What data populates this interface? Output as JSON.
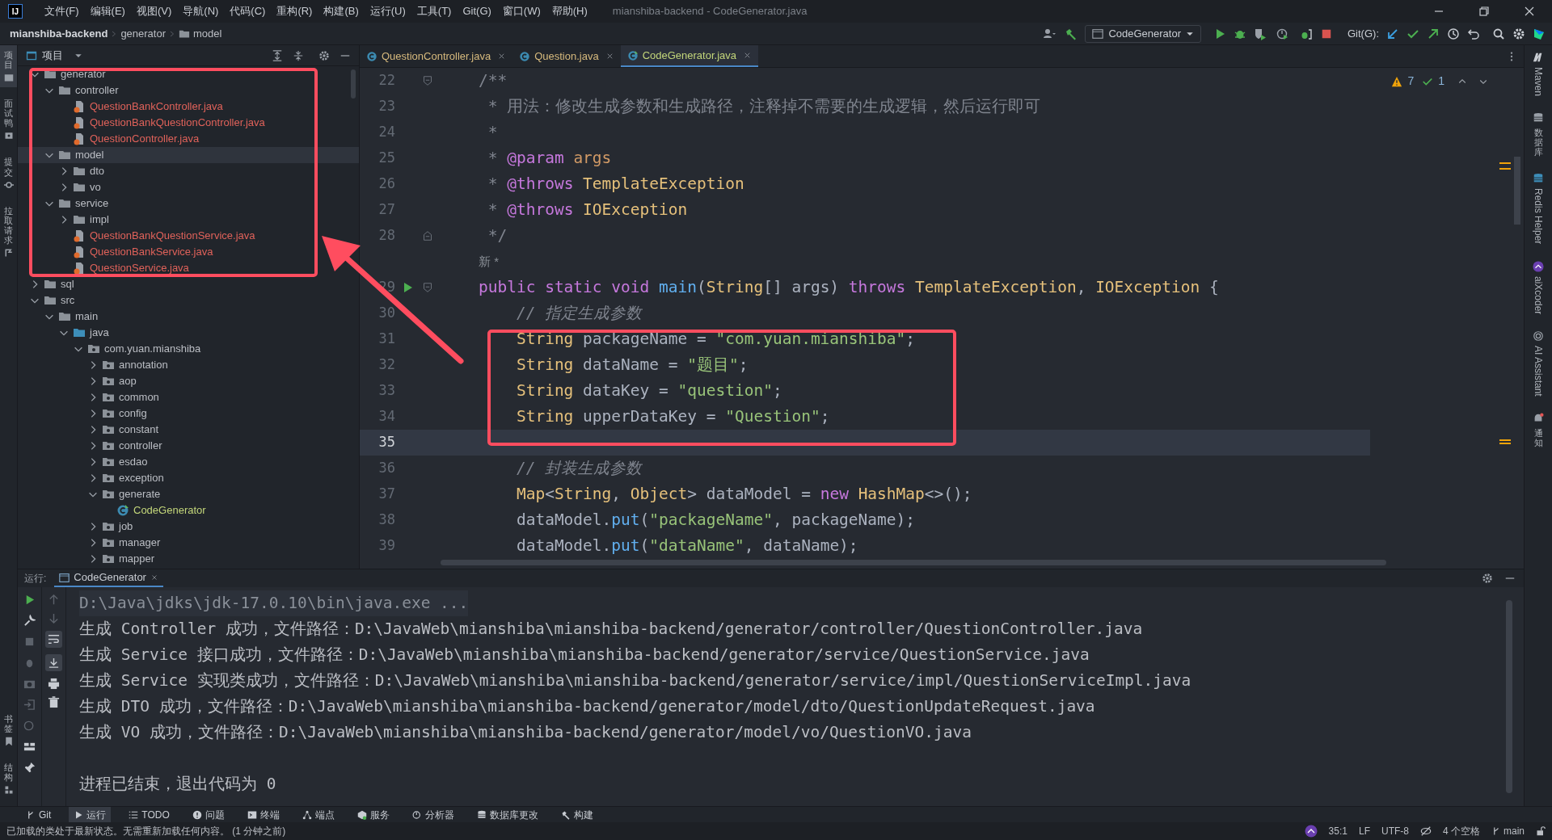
{
  "title_bar": {
    "logo": "IJ",
    "title": "mianshiba-backend - CodeGenerator.java",
    "menus": [
      "文件(F)",
      "编辑(E)",
      "视图(V)",
      "导航(N)",
      "代码(C)",
      "重构(R)",
      "构建(B)",
      "运行(U)",
      "工具(T)",
      "Git(G)",
      "窗口(W)",
      "帮助(H)"
    ]
  },
  "navigation_bar": {
    "breadcrumbs": [
      {
        "label": "mianshiba-backend",
        "kind": "project"
      },
      {
        "label": "generator",
        "kind": "plain"
      },
      {
        "label": "model",
        "kind": "folder"
      }
    ],
    "run_configuration": "CodeGenerator",
    "git_label": "Git(G):"
  },
  "left_tool_strip": {
    "top": [
      {
        "label": "项目",
        "selected": true
      },
      {
        "label": "面试鸭",
        "selected": false
      },
      {
        "label": "提交",
        "selected": false
      },
      {
        "label": "拉取请求",
        "selected": false
      }
    ],
    "bottom": [
      {
        "label": "书签",
        "selected": false
      },
      {
        "label": "结构",
        "selected": false
      }
    ]
  },
  "project_panel": {
    "title": "项目",
    "tree": [
      {
        "label": "generator",
        "kind": "folder",
        "expanded": true,
        "selected": false,
        "children": [
          {
            "label": "controller",
            "kind": "folder",
            "expanded": true,
            "selected": false,
            "children": [
              {
                "label": "QuestionBankController.java",
                "kind": "java",
                "color": "#e0625a",
                "selected": false
              },
              {
                "label": "QuestionBankQuestionController.java",
                "kind": "java",
                "color": "#e0625a",
                "selected": false
              },
              {
                "label": "QuestionController.java",
                "kind": "java",
                "color": "#e0625a",
                "selected": false
              }
            ]
          },
          {
            "label": "model",
            "kind": "folder",
            "expanded": true,
            "selected": true,
            "children": [
              {
                "label": "dto",
                "kind": "folder",
                "expanded": false,
                "selected": false
              },
              {
                "label": "vo",
                "kind": "folder",
                "expanded": false,
                "selected": false
              }
            ]
          },
          {
            "label": "service",
            "kind": "folder",
            "expanded": true,
            "selected": false,
            "children": [
              {
                "label": "impl",
                "kind": "folder",
                "expanded": false,
                "selected": false
              },
              {
                "label": "QuestionBankQuestionService.java",
                "kind": "java",
                "color": "#e0625a",
                "selected": false
              },
              {
                "label": "QuestionBankService.java",
                "kind": "java",
                "color": "#e0625a",
                "selected": false
              },
              {
                "label": "QuestionService.java",
                "kind": "java",
                "color": "#e0625a",
                "selected": false
              }
            ]
          }
        ]
      },
      {
        "label": "sql",
        "kind": "folder",
        "expanded": false,
        "selected": false
      },
      {
        "label": "src",
        "kind": "folder",
        "expanded": true,
        "selected": false,
        "children": [
          {
            "label": "main",
            "kind": "folder",
            "expanded": true,
            "selected": false,
            "children": [
              {
                "label": "java",
                "kind": "source",
                "expanded": true,
                "selected": false,
                "children": [
                  {
                    "label": "com.yuan.mianshiba",
                    "kind": "package",
                    "expanded": true,
                    "selected": false,
                    "children": [
                      {
                        "label": "annotation",
                        "kind": "package",
                        "expanded": false,
                        "selected": false
                      },
                      {
                        "label": "aop",
                        "kind": "package",
                        "expanded": false,
                        "selected": false
                      },
                      {
                        "label": "common",
                        "kind": "package",
                        "expanded": false,
                        "selected": false
                      },
                      {
                        "label": "config",
                        "kind": "package",
                        "expanded": false,
                        "selected": false
                      },
                      {
                        "label": "constant",
                        "kind": "package",
                        "expanded": false,
                        "selected": false
                      },
                      {
                        "label": "controller",
                        "kind": "package",
                        "expanded": false,
                        "selected": false
                      },
                      {
                        "label": "esdao",
                        "kind": "package",
                        "expanded": false,
                        "selected": false
                      },
                      {
                        "label": "exception",
                        "kind": "package",
                        "expanded": false,
                        "selected": false
                      },
                      {
                        "label": "generate",
                        "kind": "package",
                        "expanded": true,
                        "selected": false,
                        "children": [
                          {
                            "label": "CodeGenerator",
                            "kind": "class",
                            "color": "#c3d67a",
                            "selected": false
                          }
                        ]
                      },
                      {
                        "label": "job",
                        "kind": "package",
                        "expanded": false,
                        "selected": false
                      },
                      {
                        "label": "manager",
                        "kind": "package",
                        "expanded": false,
                        "selected": false
                      },
                      {
                        "label": "mapper",
                        "kind": "package",
                        "expanded": false,
                        "selected": false
                      }
                    ]
                  }
                ]
              }
            ]
          }
        ]
      }
    ]
  },
  "editor": {
    "tabs": [
      {
        "label": "QuestionController.java",
        "selected": false
      },
      {
        "label": "Question.java",
        "selected": false
      },
      {
        "label": "CodeGenerator.java",
        "selected": true
      }
    ],
    "inspections": {
      "warnings": "7",
      "weak_warnings": "1"
    },
    "lines": [
      {
        "kind": "code",
        "number": "22",
        "current": false,
        "fold_start": true,
        "tokens": [
          {
            "kind": "doc",
            "text": "    /**"
          }
        ]
      },
      {
        "kind": "code",
        "number": "23",
        "current": false,
        "tokens": [
          {
            "kind": "doc",
            "text": "     * 用法：修改生成参数和生成路径，注释掉不需要的生成逻辑，然后运行即可"
          }
        ]
      },
      {
        "kind": "code",
        "number": "24",
        "current": false,
        "tokens": [
          {
            "kind": "doc",
            "text": "     *"
          }
        ]
      },
      {
        "kind": "code",
        "number": "25",
        "current": false,
        "tokens": [
          {
            "kind": "doc",
            "text": "     * "
          },
          {
            "kind": "tag",
            "text": "@param"
          },
          {
            "kind": "param",
            "text": " args"
          }
        ]
      },
      {
        "kind": "code",
        "number": "26",
        "current": false,
        "tokens": [
          {
            "kind": "doc",
            "text": "     * "
          },
          {
            "kind": "tag",
            "text": "@throws"
          },
          {
            "kind": "type",
            "text": " TemplateException"
          }
        ]
      },
      {
        "kind": "code",
        "number": "27",
        "current": false,
        "tokens": [
          {
            "kind": "doc",
            "text": "     * "
          },
          {
            "kind": "tag",
            "text": "@throws"
          },
          {
            "kind": "type",
            "text": " IOException"
          }
        ]
      },
      {
        "kind": "code",
        "number": "28",
        "current": false,
        "fold_end": true,
        "tokens": [
          {
            "kind": "doc",
            "text": "     */"
          }
        ]
      },
      {
        "kind": "inlay",
        "text": "新 *"
      },
      {
        "kind": "code",
        "number": "29",
        "current": false,
        "run": true,
        "fold_start": true,
        "tokens": [
          {
            "kind": "kw",
            "text": "    public static void"
          },
          {
            "kind": "fn",
            "text": " main"
          },
          {
            "kind": "plain",
            "text": "("
          },
          {
            "kind": "type",
            "text": "String"
          },
          {
            "kind": "plain",
            "text": "[] args) "
          },
          {
            "kind": "kw",
            "text": "throws"
          },
          {
            "kind": "type",
            "text": " TemplateException"
          },
          {
            "kind": "plain",
            "text": ", "
          },
          {
            "kind": "type",
            "text": "IOException"
          },
          {
            "kind": "plain",
            "text": " {"
          }
        ]
      },
      {
        "kind": "code",
        "number": "30",
        "current": false,
        "tokens": [
          {
            "kind": "com",
            "text": "        // 指定生成参数"
          }
        ]
      },
      {
        "kind": "code",
        "number": "31",
        "current": false,
        "tokens": [
          {
            "kind": "type",
            "text": "        String"
          },
          {
            "kind": "plain",
            "text": " packageName = "
          },
          {
            "kind": "str",
            "text": "\"com.yuan.mianshiba\""
          },
          {
            "kind": "plain",
            "text": ";"
          }
        ]
      },
      {
        "kind": "code",
        "number": "32",
        "current": false,
        "tokens": [
          {
            "kind": "type",
            "text": "        String"
          },
          {
            "kind": "plain",
            "text": " dataName = "
          },
          {
            "kind": "str",
            "text": "\"题目\""
          },
          {
            "kind": "plain",
            "text": ";"
          }
        ]
      },
      {
        "kind": "code",
        "number": "33",
        "current": false,
        "tokens": [
          {
            "kind": "type",
            "text": "        String"
          },
          {
            "kind": "plain",
            "text": " dataKey = "
          },
          {
            "kind": "str",
            "text": "\"question\""
          },
          {
            "kind": "plain",
            "text": ";"
          }
        ]
      },
      {
        "kind": "code",
        "number": "34",
        "current": false,
        "tokens": [
          {
            "kind": "type",
            "text": "        String"
          },
          {
            "kind": "plain",
            "text": " upperDataKey = "
          },
          {
            "kind": "str",
            "text": "\"Question\""
          },
          {
            "kind": "plain",
            "text": ";"
          }
        ]
      },
      {
        "kind": "code",
        "number": "35",
        "current": true
      },
      {
        "kind": "code",
        "number": "36",
        "current": false,
        "tokens": [
          {
            "kind": "com",
            "text": "        // 封装生成参数"
          }
        ]
      },
      {
        "kind": "code",
        "number": "37",
        "current": false,
        "tokens": [
          {
            "kind": "type",
            "text": "        Map"
          },
          {
            "kind": "plain",
            "text": "<"
          },
          {
            "kind": "type",
            "text": "String"
          },
          {
            "kind": "plain",
            "text": ", "
          },
          {
            "kind": "type",
            "text": "Object"
          },
          {
            "kind": "plain",
            "text": "> dataModel = "
          },
          {
            "kind": "kw",
            "text": "new"
          },
          {
            "kind": "type",
            "text": " HashMap"
          },
          {
            "kind": "plain",
            "text": "<>();"
          }
        ]
      },
      {
        "kind": "code",
        "number": "38",
        "current": false,
        "tokens": [
          {
            "kind": "plain",
            "text": "        dataModel."
          },
          {
            "kind": "fn",
            "text": "put"
          },
          {
            "kind": "plain",
            "text": "("
          },
          {
            "kind": "str",
            "text": "\"packageName\""
          },
          {
            "kind": "plain",
            "text": ", packageName);"
          }
        ]
      },
      {
        "kind": "code",
        "number": "39",
        "current": false,
        "tokens": [
          {
            "kind": "plain",
            "text": "        dataModel."
          },
          {
            "kind": "fn",
            "text": "put"
          },
          {
            "kind": "plain",
            "text": "("
          },
          {
            "kind": "str",
            "text": "\"dataName\""
          },
          {
            "kind": "plain",
            "text": ", dataName);"
          }
        ]
      }
    ]
  },
  "right_tool_strip": [
    {
      "label": "Maven",
      "stacked": false,
      "kind": "maven"
    },
    {
      "label": "数据库",
      "stacked": true,
      "kind": "database"
    },
    {
      "label": "Redis Helper",
      "stacked": false,
      "kind": "redis"
    },
    {
      "label": "aiXcoder",
      "stacked": false,
      "kind": "aix"
    },
    {
      "label": "AI Assistant",
      "stacked": false,
      "kind": "spiral"
    },
    {
      "label": "通知",
      "stacked": true,
      "kind": "bell"
    }
  ],
  "run_panel": {
    "label": "运行:",
    "tab": {
      "label": "CodeGenerator",
      "selected": true
    },
    "output": [
      {
        "kind": "command",
        "text": "D:\\Java\\jdks\\jdk-17.0.10\\bin\\java.exe ..."
      },
      {
        "kind": "output",
        "text": "生成 Controller 成功，文件路径：D:\\JavaWeb\\mianshiba\\mianshiba-backend/generator/controller/QuestionController.java"
      },
      {
        "kind": "output",
        "text": "生成 Service 接口成功，文件路径：D:\\JavaWeb\\mianshiba\\mianshiba-backend/generator/service/QuestionService.java"
      },
      {
        "kind": "output",
        "text": "生成 Service 实现类成功，文件路径：D:\\JavaWeb\\mianshiba\\mianshiba-backend/generator/service/impl/QuestionServiceImpl.java"
      },
      {
        "kind": "output",
        "text": "生成 DTO 成功，文件路径：D:\\JavaWeb\\mianshiba\\mianshiba-backend/generator/model/dto/QuestionUpdateRequest.java"
      },
      {
        "kind": "output",
        "text": "生成 VO 成功，文件路径：D:\\JavaWeb\\mianshiba\\mianshiba-backend/generator/model/vo/QuestionVO.java"
      },
      {
        "kind": "exit",
        "text": "进程已结束，退出代码为 0"
      }
    ]
  },
  "tool_window_bar": [
    {
      "label": "Git",
      "kind": "git",
      "selected": false
    },
    {
      "label": "运行",
      "kind": "run",
      "selected": true
    },
    {
      "label": "TODO",
      "kind": "todo",
      "selected": false
    },
    {
      "label": "问题",
      "kind": "problems",
      "selected": false
    },
    {
      "label": "终端",
      "kind": "terminal",
      "selected": false
    },
    {
      "label": "端点",
      "kind": "endpoints",
      "selected": false
    },
    {
      "label": "服务",
      "kind": "services",
      "selected": false
    },
    {
      "label": "分析器",
      "kind": "profiler",
      "selected": false
    },
    {
      "label": "数据库更改",
      "kind": "database",
      "selected": false
    },
    {
      "label": "构建",
      "kind": "build",
      "selected": false
    }
  ],
  "status_bar": {
    "message": "已加载的类处于最新状态。无需重新加载任何内容。 (1 分钟之前)",
    "position": "35:1",
    "line_ending": "LF",
    "encoding": "UTF-8",
    "indent": "4 个空格",
    "branch": "main"
  }
}
